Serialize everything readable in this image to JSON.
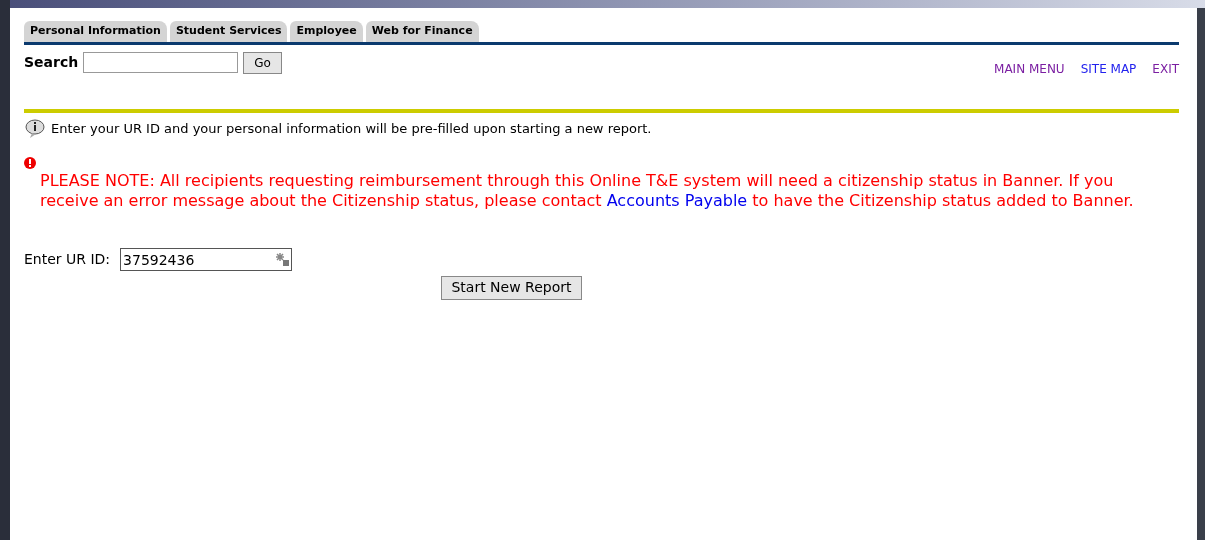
{
  "tabs": [
    {
      "label": "Personal Information",
      "selected": false
    },
    {
      "label": "Student Services",
      "selected": false
    },
    {
      "label": "Employee",
      "selected": false
    },
    {
      "label": "Web for Finance",
      "selected": false
    }
  ],
  "search": {
    "label": "Search",
    "button": "Go"
  },
  "nav_links": [
    {
      "label": "MAIN MENU",
      "visited": true
    },
    {
      "label": "SITE MAP",
      "visited": false
    },
    {
      "label": "EXIT",
      "visited": true
    }
  ],
  "info_message": "Enter your UR ID and your personal information will be pre-filled upon starting a new report.",
  "warning": {
    "before": "PLEASE NOTE: All recipients requesting reimbursement through this Online T&E system will need a citizenship status in Banner. If you receive an error message about the Citizenship status, please contact",
    "link": "Accounts Payable",
    "after": "to have the Citizenship status added to Banner."
  },
  "ur_id": {
    "label": "Enter UR ID:",
    "value": "37592436"
  },
  "start_button": "Start New Report"
}
